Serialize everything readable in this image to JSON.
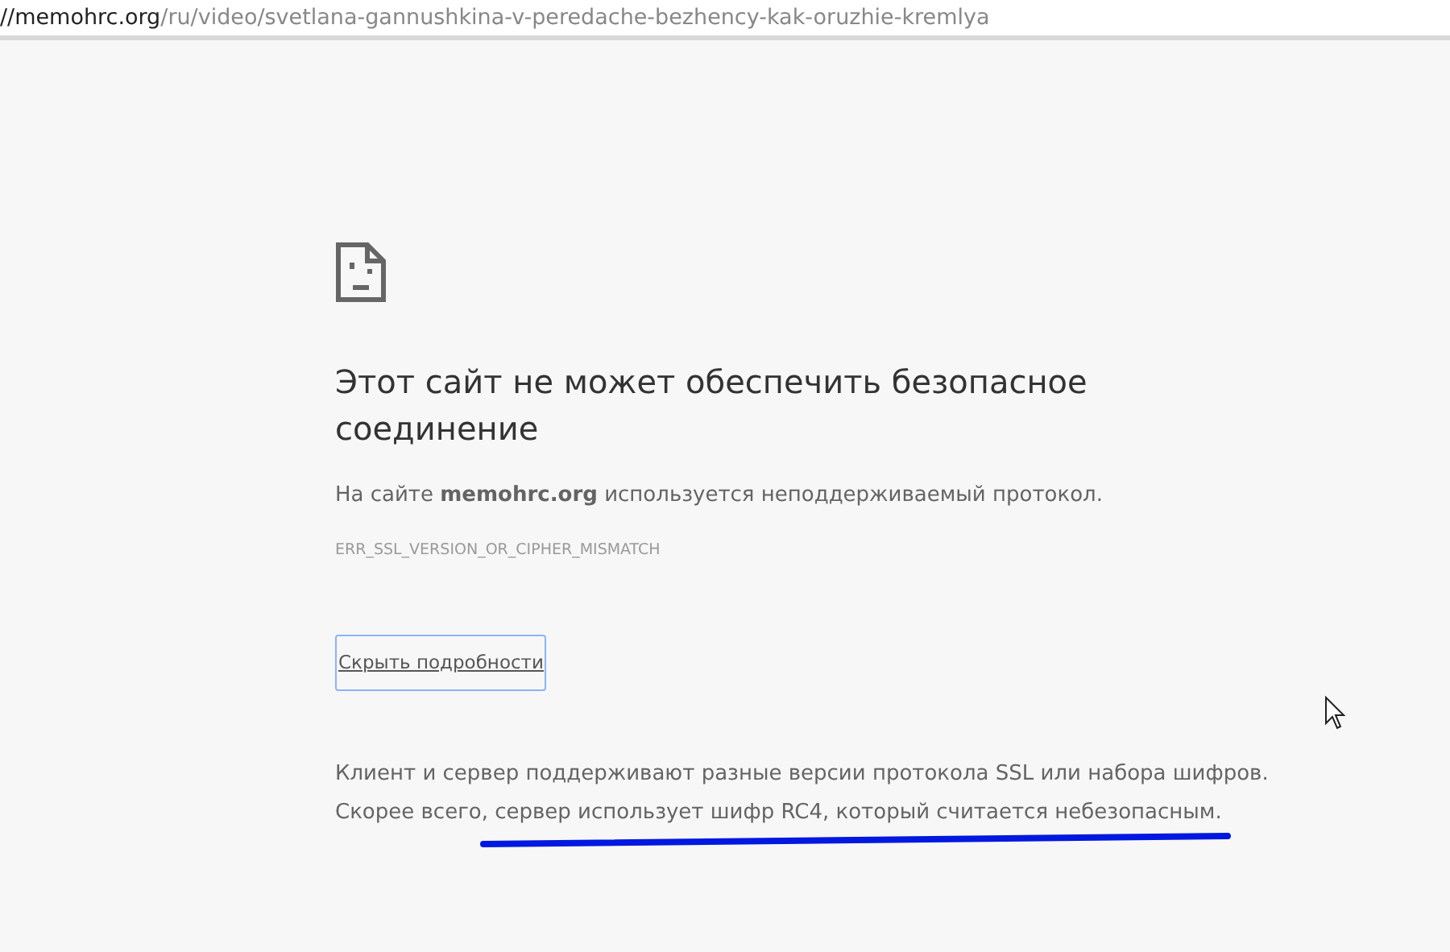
{
  "address_bar": {
    "host": "//memohrc.org",
    "path": "/ru/video/svetlana-gannushkina-v-peredache-bezhency-kak-oruzhie-kremlya"
  },
  "error": {
    "heading": "Этот сайт не может обеспечить безопасное соединение",
    "summary": "На сайте **memohrc.org** используется неподдерживаемый протокол.",
    "code": "ERR_SSL_VERSION_OR_CIPHER_MISMATCH",
    "details_button": {
      "label": "Скрыть подробности",
      "focused": true
    },
    "details": [
      "Клиент и сервер поддерживают разные версии протокола SSL или набора шифров.",
      "Скорее всего, сервер использует шифр RC4, который считается небезопасным."
    ]
  }
}
